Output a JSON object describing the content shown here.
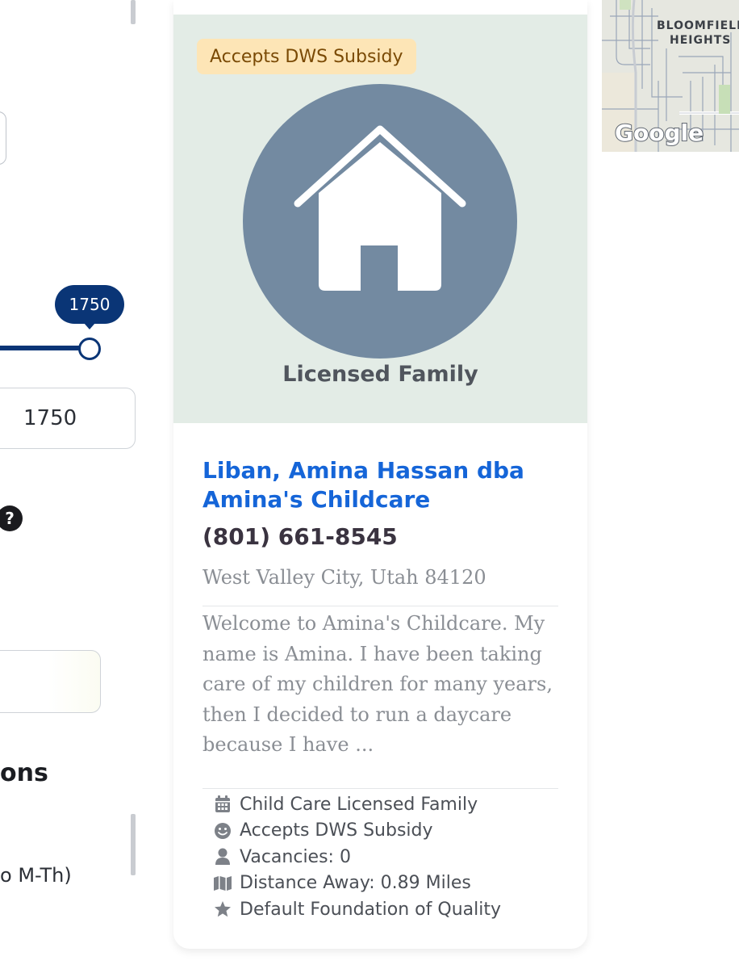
{
  "filters": {
    "slider_value": "1750",
    "input_value": "1750",
    "help_symbol": "?",
    "section_heading_fragment": "ons",
    "schedule_fragment": "o M-Th)"
  },
  "card": {
    "badge": "Accepts DWS Subsidy",
    "hero_label": "Licensed Family",
    "name": "Liban, Amina Hassan dba Amina's Childcare",
    "phone": "(801) 661-8545",
    "location": "West Valley City, Utah 84120",
    "description": "Welcome to Amina's Childcare. My name is Amina. I have been taking care of my children for many years, then I decided to run a daycare because I have ...",
    "features": [
      {
        "icon": "calendar-icon",
        "label": "Child Care Licensed Family"
      },
      {
        "icon": "smile-icon",
        "label": "Accepts DWS Subsidy"
      },
      {
        "icon": "user-icon",
        "label": "Vacancies: 0"
      },
      {
        "icon": "map-icon",
        "label": "Distance Away: 0.89 Miles"
      },
      {
        "icon": "star-icon",
        "label": "Default Foundation of Quality"
      }
    ]
  },
  "map": {
    "area_label_1": "BLOOMFIELD",
    "area_label_2": "HEIGHTS",
    "logo": "Google"
  },
  "colors": {
    "primary_navy": "#0a3576",
    "link_blue": "#1565d8",
    "hero_bg": "#e3ece6",
    "house_circle": "#738aa1",
    "badge_bg": "#fde5b6",
    "badge_text": "#7a4a05"
  }
}
